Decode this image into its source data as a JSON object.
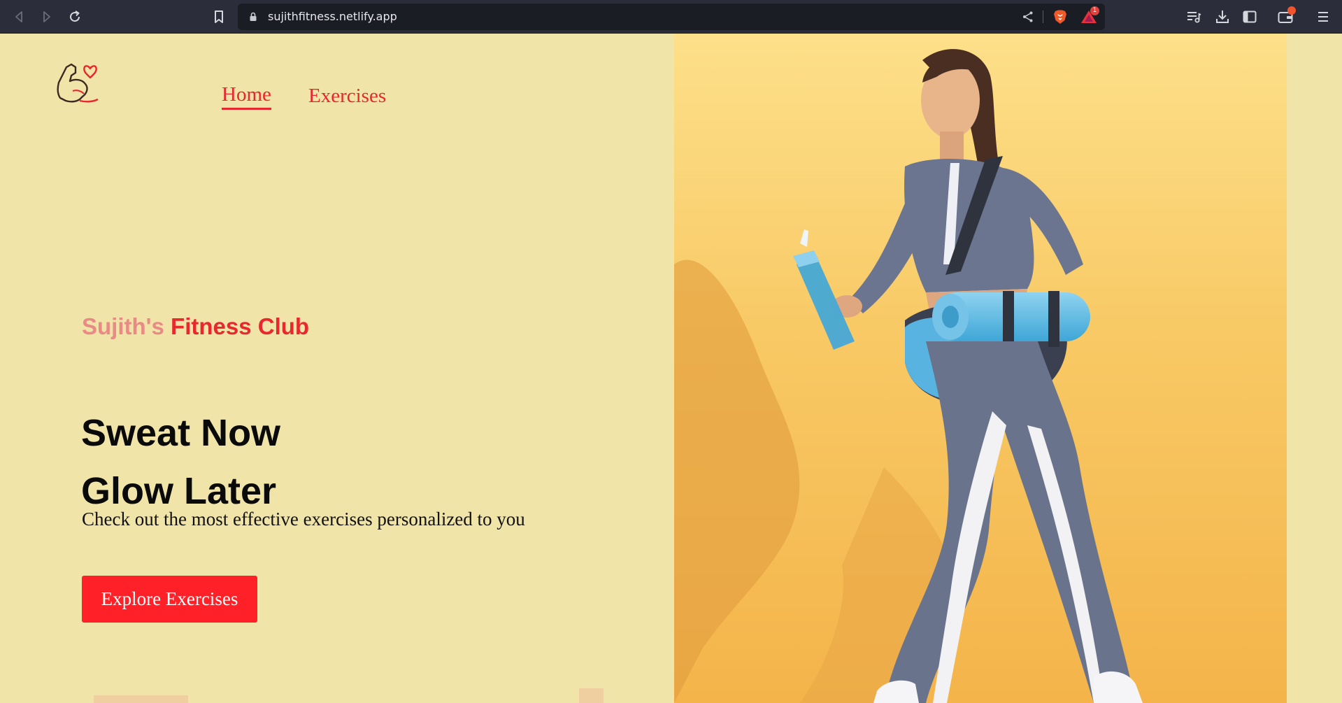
{
  "browser": {
    "url": "sujithfitness.netlify.app",
    "notification_count": "1",
    "icons": {
      "back": "back-icon",
      "forward": "forward-icon",
      "reload": "reload-icon",
      "bookmark": "bookmark-icon",
      "lock": "lock-icon",
      "share": "share-icon",
      "brave_shields": "brave-lion-icon",
      "brave_rewards": "rewards-triangle-icon",
      "playlist": "playlist-icon",
      "downloads": "download-icon",
      "sidebar": "sidebar-icon",
      "wallet": "wallet-icon",
      "menu": "hamburger-menu-icon"
    }
  },
  "site": {
    "logo": "flexed-arm-heart-logo",
    "nav": {
      "home": "Home",
      "exercises": "Exercises"
    },
    "hero": {
      "club_name_part1": "Sujith's",
      "club_name_part2": "Fitness Club",
      "title_line1": "Sweat Now",
      "title_line2": "Glow Later",
      "subtitle": "Check out the most effective exercises personalized to you",
      "cta": "Explore Exercises"
    },
    "colors": {
      "background": "#f0e4a8",
      "accent": "#e8272e",
      "accent_soft": "#e98a86",
      "button": "#ff2127",
      "image_bg": "#f7c45e"
    }
  }
}
